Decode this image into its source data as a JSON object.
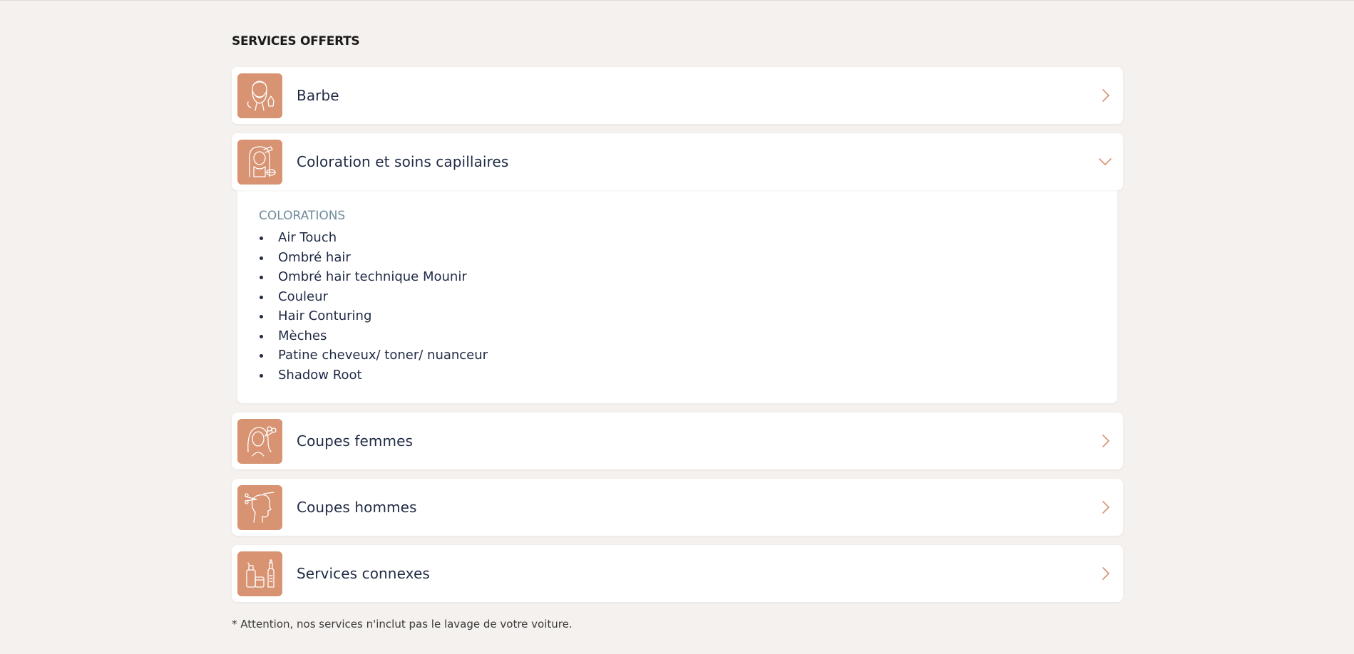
{
  "section": {
    "title": "SERVICES OFFERTS"
  },
  "colors": {
    "accent": "#d79372",
    "background": "#f4f1ee",
    "text": "#1f2a44",
    "category_title": "#6f8c9a"
  },
  "services": [
    {
      "label": "Barbe",
      "icon": "beard-icon",
      "state": "collapsed"
    },
    {
      "label": "Coloration et soins capillaires",
      "icon": "hair-coloring-icon",
      "state": "expanded"
    },
    {
      "label": "Coupes femmes",
      "icon": "woman-haircut-icon",
      "state": "collapsed"
    },
    {
      "label": "Coupes hommes",
      "icon": "man-haircut-icon",
      "state": "collapsed"
    },
    {
      "label": "Services connexes",
      "icon": "hair-products-icon",
      "state": "collapsed"
    }
  ],
  "expanded": {
    "category": "COLORATIONS",
    "items": [
      "Air Touch",
      "Ombré hair",
      "Ombré hair technique Mounir",
      "Couleur",
      "Hair Conturing",
      "Mèches",
      "Patine cheveux/ toner/ nuanceur",
      "Shadow Root"
    ]
  },
  "footnote": "* Attention, nos services n'inclut pas le lavage de votre voiture."
}
